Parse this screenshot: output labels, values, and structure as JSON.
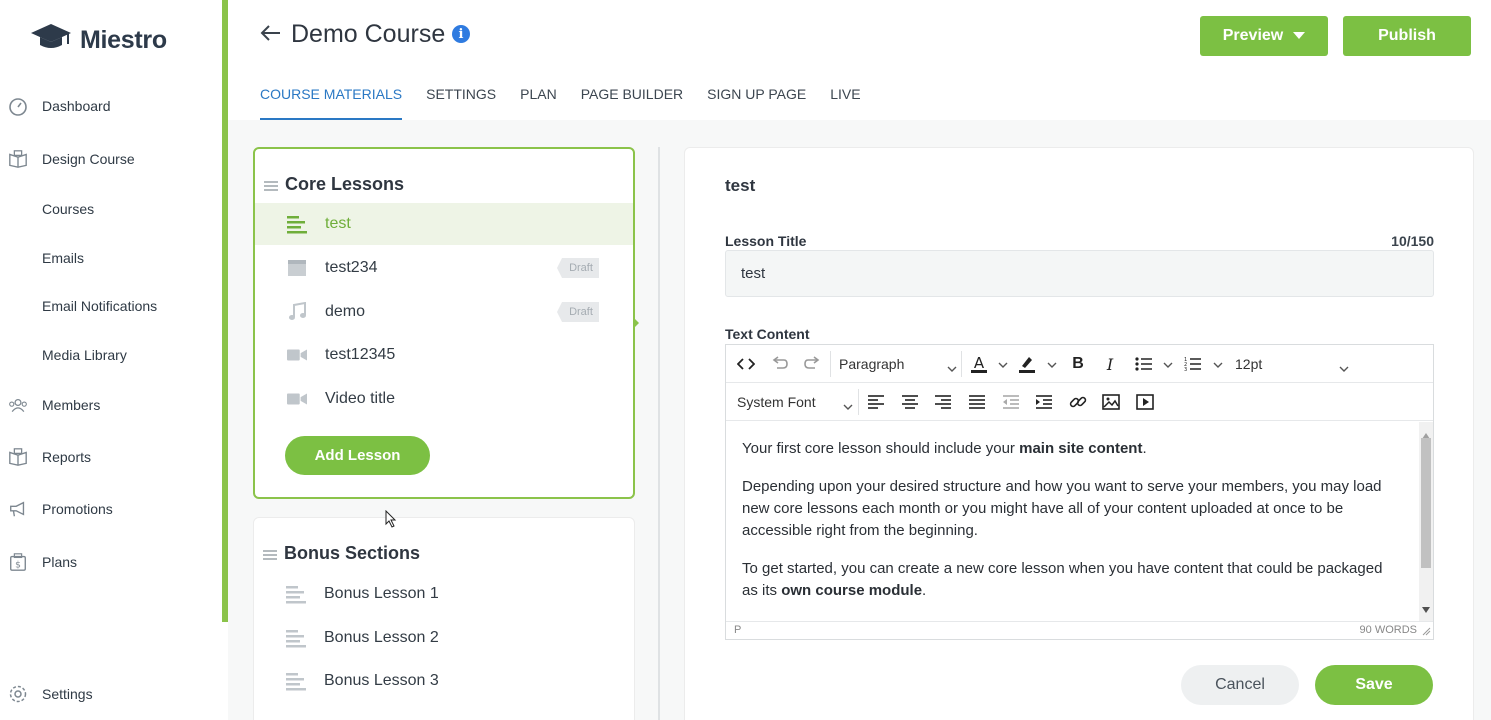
{
  "app": {
    "logo_text": "Miestro"
  },
  "sidebar": {
    "items": [
      {
        "label": "Dashboard",
        "icon": "dashboard-icon"
      },
      {
        "label": "Design Course",
        "icon": "book-icon"
      },
      {
        "label": "Courses",
        "icon": ""
      },
      {
        "label": "Emails",
        "icon": ""
      },
      {
        "label": "Email Notifications",
        "icon": ""
      },
      {
        "label": "Media Library",
        "icon": ""
      },
      {
        "label": "Members",
        "icon": "members-icon"
      },
      {
        "label": "Reports",
        "icon": "reports-icon"
      },
      {
        "label": "Promotions",
        "icon": "megaphone-icon"
      },
      {
        "label": "Plans",
        "icon": "plans-icon"
      },
      {
        "label": "Settings",
        "icon": "gear-icon"
      }
    ]
  },
  "header": {
    "title": "Demo Course",
    "preview_label": "Preview",
    "publish_label": "Publish",
    "tabs": [
      {
        "label": "COURSE MATERIALS",
        "active": true
      },
      {
        "label": "SETTINGS",
        "active": false
      },
      {
        "label": "PLAN",
        "active": false
      },
      {
        "label": "PAGE BUILDER",
        "active": false
      },
      {
        "label": "SIGN UP PAGE",
        "active": false
      },
      {
        "label": "LIVE",
        "active": false
      }
    ]
  },
  "core_section": {
    "title": "Core Lessons",
    "lessons": [
      {
        "label": "test",
        "type": "text",
        "icon": "text-lines-icon",
        "draft": false,
        "active": true
      },
      {
        "label": "test234",
        "type": "page",
        "icon": "page-icon",
        "draft": true,
        "badge": "Draft",
        "active": false
      },
      {
        "label": "demo",
        "type": "audio",
        "icon": "music-note-icon",
        "draft": true,
        "badge": "Draft",
        "active": false
      },
      {
        "label": "test12345",
        "type": "video",
        "icon": "video-camera-icon",
        "draft": false,
        "active": false
      },
      {
        "label": "Video title",
        "type": "video",
        "icon": "video-camera-icon",
        "draft": false,
        "active": false
      }
    ],
    "add_label": "Add Lesson"
  },
  "bonus_section": {
    "title": "Bonus Sections",
    "lessons": [
      {
        "label": "Bonus Lesson 1",
        "icon": "text-lines-icon"
      },
      {
        "label": "Bonus Lesson 2",
        "icon": "text-lines-icon"
      },
      {
        "label": "Bonus Lesson 3",
        "icon": "text-lines-icon"
      }
    ]
  },
  "editor": {
    "heading": "test",
    "lesson_title_label": "Lesson Title",
    "char_count": "10/150",
    "lesson_title_value": "test",
    "text_content_label": "Text Content",
    "toolbar": {
      "block_format": "Paragraph",
      "font_size": "12pt",
      "font_family": "System Font"
    },
    "content": {
      "p1_a": "Your first core lesson should include your ",
      "p1_b": "main site content",
      "p1_c": ".",
      "p2": "Depending upon your desired structure and how you want to serve your members, you may load new core lessons each month or you might have all of your content uploaded at once to be accessible right from the beginning.",
      "p3_a": "To get started, you can create a new core lesson when you have content that could be packaged as its ",
      "p3_b": "own course module",
      "p3_c": "."
    },
    "status_path": "P",
    "word_count": "90 WORDS",
    "cancel_label": "Cancel",
    "save_label": "Save"
  },
  "colors": {
    "accent_green": "#7cc043",
    "tab_blue": "#2a78c4",
    "info_blue": "#2f7be0"
  }
}
